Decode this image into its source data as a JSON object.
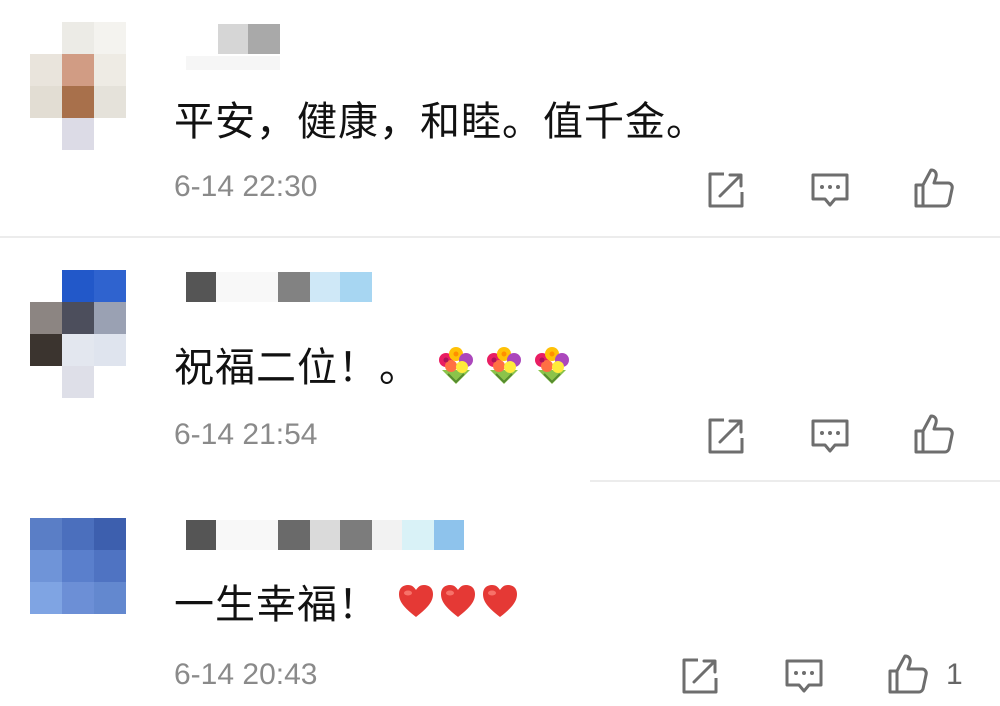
{
  "comments": [
    {
      "text": "平安，健康，和睦。值千金。",
      "time": "6-14 22:30",
      "emojis": []
    },
    {
      "text": "祝福二位！。",
      "time": "6-14 21:54",
      "emojis": [
        "bouquet",
        "bouquet",
        "bouquet"
      ]
    },
    {
      "text": "一生幸福！",
      "time": "6-14 20:43",
      "emojis": [
        "heart",
        "heart",
        "heart"
      ],
      "like_count": "1"
    }
  ],
  "icons": {
    "share": "share-icon",
    "reply": "reply-icon",
    "like": "thumbs-up-icon"
  },
  "colors": {
    "text": "#111111",
    "timestamp": "#8a8a8a",
    "icon": "#6e6e6e",
    "divider": "#ececec",
    "heart": "#e53935"
  }
}
